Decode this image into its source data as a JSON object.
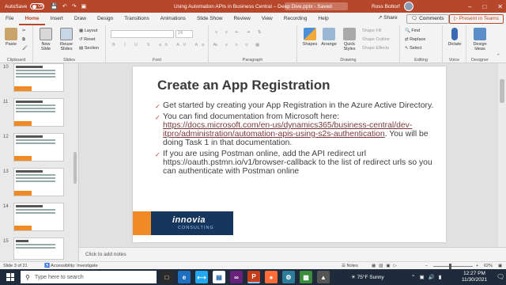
{
  "titlebar": {
    "autosave_label": "AutoSave",
    "autosave_state": "Off",
    "document_title": "Using Automation APIs in Business Central – Deep Dive.pptx  -  Saved",
    "user_name": "Ross Bottorf",
    "quick_access": [
      "save-icon",
      "undo-icon",
      "redo-icon",
      "present-icon"
    ]
  },
  "tabs": [
    "File",
    "Home",
    "Insert",
    "Draw",
    "Design",
    "Transitions",
    "Animations",
    "Slide Show",
    "Review",
    "View",
    "Recording",
    "Help"
  ],
  "active_tab": "Home",
  "header_actions": {
    "share": "Share",
    "comments": "Comments",
    "present": "Present in Teams"
  },
  "ribbon": {
    "clipboard": {
      "label": "Clipboard",
      "paste": "Paste"
    },
    "slides": {
      "label": "Slides",
      "new_slide": "New Slide",
      "reuse_slides": "Reuse Slides",
      "layout": "Layout",
      "reset": "Reset",
      "section": "Section"
    },
    "font": {
      "label": "Font",
      "size": "24"
    },
    "paragraph": {
      "label": "Paragraph"
    },
    "drawing": {
      "label": "Drawing",
      "shapes": "Shapes",
      "arrange": "Arrange",
      "quick_styles": "Quick Styles",
      "shape_fill": "Shape Fill",
      "shape_outline": "Shape Outline",
      "shape_effects": "Shape Effects"
    },
    "editing": {
      "label": "Editing",
      "find": "Find",
      "replace": "Replace",
      "select": "Select"
    },
    "voice": {
      "label": "Voice",
      "dictate": "Dictate"
    },
    "designer": {
      "label": "Designer",
      "design_ideas": "Design Ideas"
    }
  },
  "thumbnails": [
    {
      "number": "10",
      "title": "Automation API (Cont)"
    },
    {
      "number": "11",
      "title": "Automation API (Cont)"
    },
    {
      "number": "12",
      "title": "Automation API (Cont)"
    },
    {
      "number": "13",
      "title": "Automation API (Cont)"
    },
    {
      "number": "14",
      "title": "Automation API (Cont)"
    },
    {
      "number": "15",
      "title": "Demo"
    }
  ],
  "slide": {
    "title": "Create an App Registration",
    "bullet1": "Get started by creating your App Registration in the Azure Active Directory.",
    "bullet2_pre": "You can find documentation from Microsoft here: ",
    "bullet2_link": "https://docs.microsoft.com/en-us/dynamics365/business-central/dev-itpro/administration/automation-apis-using-s2s-authentication",
    "bullet2_post": ". You will be doing Task 1 in that documentation.",
    "bullet3": "If you are using Postman online, add the API redirect url https://oauth.pstmn.io/v1/browser-callback to the list of redirect urls so you can authenticate with Postman online",
    "logo_name": "innovia",
    "logo_sub": "CONSULTING"
  },
  "notes_placeholder": "Click to add notes",
  "statusbar": {
    "slide_info": "Slide 3 of 21",
    "accessibility": "Accessibility: Investigate",
    "notes": "Notes",
    "zoom": "62%"
  },
  "taskbar": {
    "search_placeholder": "Type here to search",
    "weather": "75°F  Sunny",
    "time": "12:27 PM",
    "date": "11/30/2021"
  },
  "colors": {
    "accent": "#b7472a",
    "brand_orange": "#f08a24",
    "brand_navy": "#17365d"
  }
}
